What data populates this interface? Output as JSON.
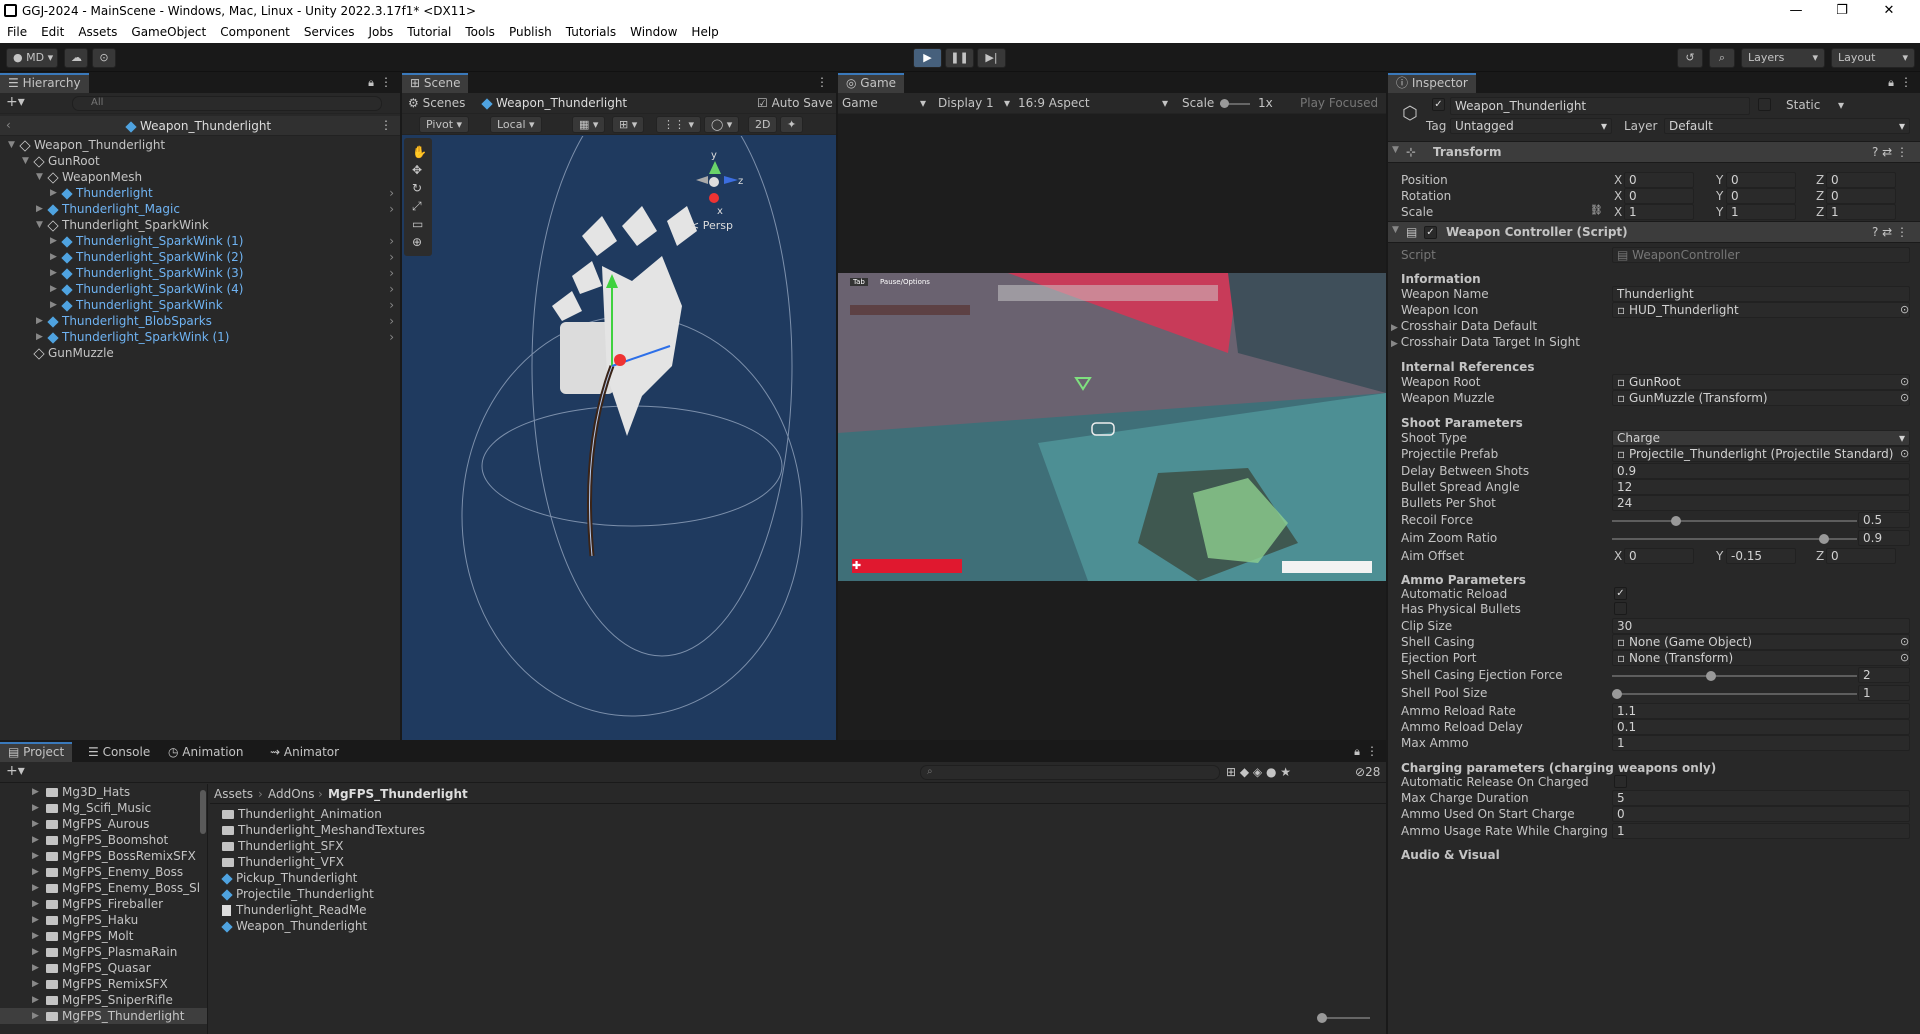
{
  "window": {
    "title": "GGJ-2024 - MainScene - Windows, Mac, Linux - Unity 2022.3.17f1* <DX11>",
    "min": "—",
    "max": "❐",
    "close": "✕"
  },
  "menu": [
    "File",
    "Edit",
    "Assets",
    "GameObject",
    "Component",
    "Services",
    "Jobs",
    "Tutorial",
    "Tools",
    "Publish",
    "Tutorials",
    "Window",
    "Help"
  ],
  "toolbar": {
    "account": "MD",
    "layers": "Layers",
    "layout": "Layout"
  },
  "hierarchy": {
    "tab": "Hierarchy",
    "search_placeholder": "All",
    "context": "Weapon_Thunderlight",
    "items": [
      {
        "label": "Weapon_Thunderlight",
        "depth": 0,
        "icon": "gray",
        "exp": true
      },
      {
        "label": "GunRoot",
        "depth": 1,
        "icon": "gray",
        "exp": true
      },
      {
        "label": "WeaponMesh",
        "depth": 2,
        "icon": "gray",
        "exp": true
      },
      {
        "label": "Thunderlight",
        "depth": 3,
        "icon": "blue",
        "exp": false,
        "child": true
      },
      {
        "label": "Thunderlight_Magic",
        "depth": 2,
        "icon": "blue",
        "exp": false,
        "child": true
      },
      {
        "label": "Thunderlight_SparkWink",
        "depth": 2,
        "icon": "gray",
        "exp": true
      },
      {
        "label": "Thunderlight_SparkWink (1)",
        "depth": 3,
        "icon": "blue",
        "child": true
      },
      {
        "label": "Thunderlight_SparkWink (2)",
        "depth": 3,
        "icon": "blue",
        "child": true
      },
      {
        "label": "Thunderlight_SparkWink (3)",
        "depth": 3,
        "icon": "blue",
        "child": true
      },
      {
        "label": "Thunderlight_SparkWink (4)",
        "depth": 3,
        "icon": "blue",
        "child": true
      },
      {
        "label": "Thunderlight_SparkWink",
        "depth": 3,
        "icon": "blue",
        "child": true
      },
      {
        "label": "Thunderlight_BlobSparks",
        "depth": 2,
        "icon": "blue",
        "child": true
      },
      {
        "label": "Thunderlight_SparkWink (1)",
        "depth": 2,
        "icon": "blue",
        "child": true
      },
      {
        "label": "GunMuzzle",
        "depth": 1,
        "icon": "gray"
      }
    ]
  },
  "scene": {
    "tab": "Scene",
    "scenes": "Scenes",
    "breadcrumb": "Weapon_Thunderlight",
    "autosave": "Auto Save",
    "pivot": "Pivot",
    "local": "Local",
    "mode2d": "2D",
    "persp": "< Persp",
    "axis_y": "y",
    "axis_z": "z",
    "axis_x": "x"
  },
  "game": {
    "tab": "Game",
    "mode": "Game",
    "display": "Display 1",
    "aspect": "16:9 Aspect",
    "scale_label": "Scale",
    "scale_value": "1x",
    "play_focused": "Play Focused",
    "hud_tab": "Tab",
    "hud_pause": "Pause/Options"
  },
  "inspector": {
    "tab": "Inspector",
    "object_name": "Weapon_Thunderlight",
    "static": "Static",
    "tag_label": "Tag",
    "tag": "Untagged",
    "layer_label": "Layer",
    "layer": "Default",
    "transform": {
      "title": "Transform",
      "position": "Position",
      "rotation": "Rotation",
      "scale": "Scale",
      "pos": [
        "0",
        "0",
        "0"
      ],
      "rot": [
        "0",
        "0",
        "0"
      ],
      "scl": [
        "1",
        "1",
        "1"
      ]
    },
    "script_comp": "Weapon Controller (Script)",
    "script_label": "Script",
    "script_value": "WeaponController",
    "info_head": "Information",
    "weapon_name_l": "Weapon Name",
    "weapon_name": "Thunderlight",
    "weapon_icon_l": "Weapon Icon",
    "weapon_icon": "HUD_Thunderlight",
    "crosshair_default": "Crosshair Data Default",
    "crosshair_sight": "Crosshair Data Target In Sight",
    "internal_head": "Internal References",
    "weapon_root_l": "Weapon Root",
    "weapon_root": "GunRoot",
    "weapon_muzzle_l": "Weapon Muzzle",
    "weapon_muzzle": "GunMuzzle (Transform)",
    "shoot_head": "Shoot Parameters",
    "shoot_type_l": "Shoot Type",
    "shoot_type": "Charge",
    "proj_l": "Projectile Prefab",
    "proj": "Projectile_Thunderlight (Projectile Standard)",
    "delay_l": "Delay Between Shots",
    "delay": "0.9",
    "spread_l": "Bullet Spread Angle",
    "spread": "12",
    "bps_l": "Bullets Per Shot",
    "bps": "24",
    "recoil_l": "Recoil Force",
    "recoil": "0.5",
    "recoil_frac": 0.25,
    "aimzoom_l": "Aim Zoom Ratio",
    "aimzoom": "0.9",
    "aimzoom_frac": 0.88,
    "aimoff_l": "Aim Offset",
    "aimoff": [
      "0",
      "-0.15",
      "0"
    ],
    "ammo_head": "Ammo Parameters",
    "autoreload_l": "Automatic Reload",
    "physbul_l": "Has Physical Bullets",
    "clip_l": "Clip Size",
    "clip": "30",
    "shell_l": "Shell Casing",
    "shell": "None (Game Object)",
    "eject_l": "Ejection Port",
    "eject": "None (Transform)",
    "ejectforce_l": "Shell Casing Ejection Force",
    "ejectforce": "2",
    "ejectforce_frac": 0.4,
    "pool_l": "Shell Pool Size",
    "pool": "1",
    "pool_frac": 0.0,
    "reloadrate_l": "Ammo Reload Rate",
    "reloadrate": "1.1",
    "reloaddelay_l": "Ammo Reload Delay",
    "reloaddelay": "0.1",
    "maxammo_l": "Max Ammo",
    "maxammo": "1",
    "charge_head": "Charging parameters (charging weapons only)",
    "autorelease_l": "Automatic Release On Charged",
    "maxcharge_l": "Max Charge Duration",
    "maxcharge": "5",
    "ammostart_l": "Ammo Used On Start Charge",
    "ammostart": "0",
    "usagerate_l": "Ammo Usage Rate While Charging",
    "usagerate": "1",
    "audio_head": "Audio & Visual"
  },
  "project": {
    "tabs": [
      "Project",
      "Console",
      "Animation",
      "Animator"
    ],
    "count": "28",
    "breadcrumb": [
      "Assets",
      "AddOns",
      "MgFPS_Thunderlight"
    ],
    "tree": [
      "Mg3D_Hats",
      "Mg_Scifi_Music",
      "MgFPS_Aurous",
      "MgFPS_Boomshot",
      "MgFPS_BossRemixSFX",
      "MgFPS_Enemy_Boss",
      "MgFPS_Enemy_Boss_Sl",
      "MgFPS_Fireballer",
      "MgFPS_Haku",
      "MgFPS_Molt",
      "MgFPS_PlasmaRain",
      "MgFPS_Quasar",
      "MgFPS_RemixSFX",
      "MgFPS_SniperRifle",
      "MgFPS_Thunderlight"
    ],
    "files": [
      {
        "label": "Thunderlight_Animation",
        "type": "folder"
      },
      {
        "label": "Thunderlight_MeshandTextures",
        "type": "folder"
      },
      {
        "label": "Thunderlight_SFX",
        "type": "folder"
      },
      {
        "label": "Thunderlight_VFX",
        "type": "folder"
      },
      {
        "label": "Pickup_Thunderlight",
        "type": "prefab"
      },
      {
        "label": "Projectile_Thunderlight",
        "type": "prefab"
      },
      {
        "label": "Thunderlight_ReadMe",
        "type": "doc"
      },
      {
        "label": "Weapon_Thunderlight",
        "type": "prefab"
      }
    ]
  }
}
